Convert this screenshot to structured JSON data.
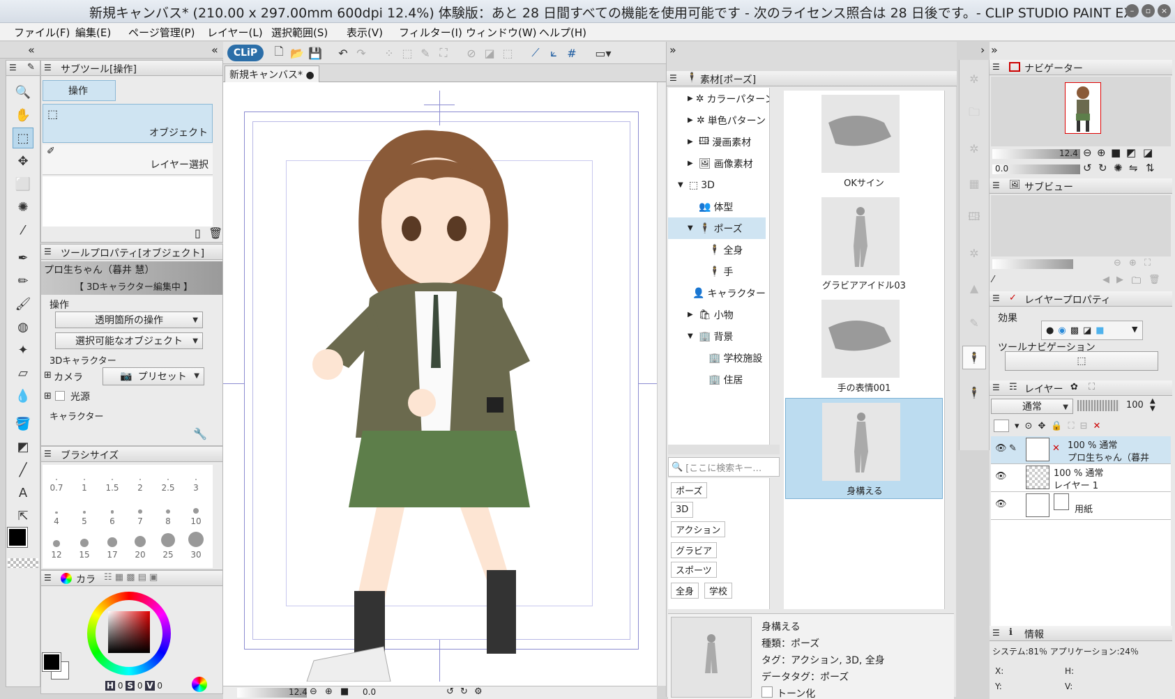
{
  "window": {
    "title": "新規キャンバス* (210.00 x 297.00mm 600dpi 12.4%)  体験版：あと 28 日間すべての機能を使用可能です - 次のライセンス照合は 28 日後です。- CLIP STUDIO PAINT EX"
  },
  "menu": [
    "ファイル(F)",
    "編集(E)",
    "ページ管理(P)",
    "レイヤー(L)",
    "選択範囲(S)",
    "表示(V)",
    "フィルター(I)",
    "ウィンドウ(W)",
    "ヘルプ(H)"
  ],
  "toolbar": {
    "logo": "CLiP"
  },
  "subtool": {
    "title": "サブツール[操作]",
    "tab": "操作",
    "items": [
      "オブジェクト",
      "レイヤー選択"
    ]
  },
  "toolprop": {
    "title": "ツールプロパティ[オブジェクト]",
    "name": "プロ生ちゃん（暮井 慧）",
    "mode": "【 3Dキャラクター編集中 】",
    "section_op": "操作",
    "dd1": "透明箇所の操作",
    "dd2": "選択可能なオブジェクト",
    "sub3d": "3Dキャラクター",
    "camera": "カメラ",
    "preset": "プリセット",
    "light": "光源",
    "chara": "キャラクター"
  },
  "brushsize": {
    "title": "ブラシサイズ",
    "sizes": [
      "0.7",
      "1",
      "1.5",
      "2",
      "2.5",
      "3",
      "4",
      "5",
      "6",
      "7",
      "8",
      "10",
      "12",
      "15",
      "17",
      "20",
      "25",
      "30"
    ]
  },
  "color": {
    "tab": "カラ",
    "h": "0",
    "s": "0",
    "v": "0",
    "fg": "#000000",
    "bg": "#ffffff"
  },
  "canvas": {
    "tab": "新規キャンバス*",
    "zoom": "12.4",
    "angle": "0.0"
  },
  "material": {
    "title": "素材[ポーズ]",
    "tree": [
      "カラーパターン",
      "単色パターン",
      "漫画素材",
      "画像素材",
      "3D",
      "体型",
      "ポーズ",
      "全身",
      "手",
      "キャラクター",
      "小物",
      "背景",
      "学校施設",
      "住居"
    ],
    "search_placeholder": "[ここに検索キー…",
    "tags": [
      "ポーズ",
      "3D",
      "アクション",
      "グラビア",
      "スポーツ",
      "全身",
      "学校"
    ],
    "items": [
      "OKサイン",
      "グラビアアイドル03",
      "手の表情001",
      "身構える"
    ],
    "detail": {
      "name": "身構える",
      "kind": "種類：ポーズ",
      "tags": "タグ：アクション, 3D, 全身",
      "datatag": "データタグ：ポーズ",
      "tone": "トーン化"
    }
  },
  "navigator": {
    "title": "ナビゲーター",
    "zoom": "12.4",
    "angle": "0.0"
  },
  "subview": {
    "title": "サブビュー"
  },
  "layerprop": {
    "title": "レイヤープロパティ",
    "effect": "効果",
    "toolnav": "ツールナビゲーション"
  },
  "layers": {
    "title": "レイヤー",
    "blend": "通常",
    "opacity": "100",
    "rows": [
      {
        "mode": "100 % 通常",
        "name": "プロ生ちゃん（暮井"
      },
      {
        "mode": "100 % 通常",
        "name": "レイヤー 1"
      },
      {
        "mode": "",
        "name": "用紙"
      }
    ]
  },
  "info": {
    "title": "情報",
    "system": "システム:81％ アプリケーション:24％",
    "x": "X:",
    "y": "Y:",
    "h": "H:",
    "v": "V:"
  }
}
